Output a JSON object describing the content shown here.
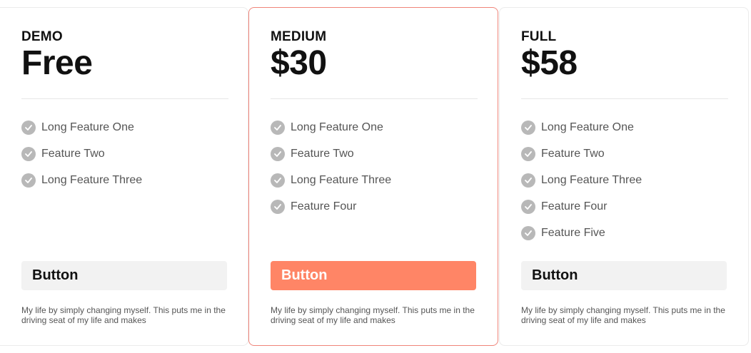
{
  "plans": [
    {
      "name": "DEMO",
      "price": "Free",
      "features": [
        "Long Feature One",
        "Feature Two",
        "Long Feature Three"
      ],
      "button_label": "Button",
      "description": "My life by simply changing myself. This puts me in the driving seat of my life and makes"
    },
    {
      "name": "MEDIUM",
      "price": "$30",
      "features": [
        "Long Feature One",
        "Feature Two",
        "Long Feature Three",
        "Feature Four"
      ],
      "button_label": "Button",
      "description": "My life by simply changing myself. This puts me in the driving seat of my life and makes"
    },
    {
      "name": "FULL",
      "price": "$58",
      "features": [
        "Long Feature One",
        "Feature Two",
        "Long Feature Three",
        "Feature Four",
        "Feature Five"
      ],
      "button_label": "Button",
      "description": "My life by simply changing myself. This puts me in the driving seat of my life and makes"
    }
  ],
  "featured_plan_index": 1,
  "colors": {
    "accent": "#ff8566",
    "featured_border": "#f0857a",
    "check_icon": "#b8b8b8",
    "secondary_button": "#f2f2f2"
  },
  "icons": {
    "feature_check": "check-circle-icon"
  }
}
